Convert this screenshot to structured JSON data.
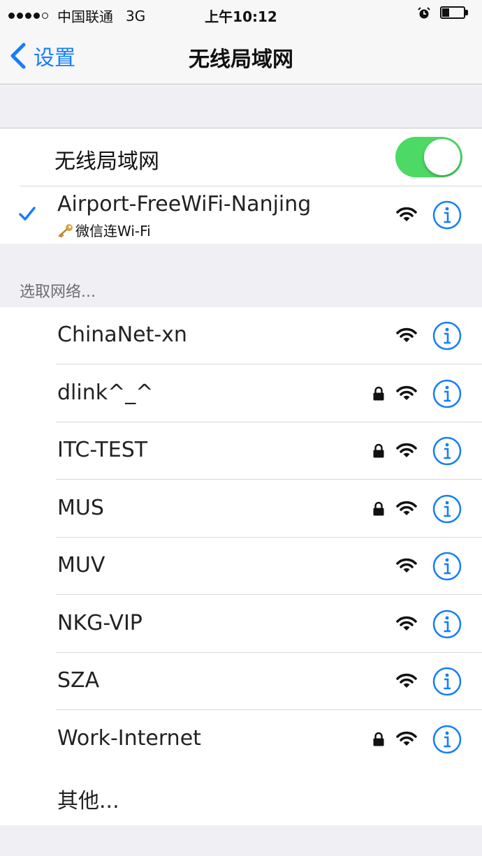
{
  "status_bar": {
    "carrier": "中国联通",
    "network": "3G",
    "time": "上午10:12"
  },
  "nav": {
    "back_label": "设置",
    "title": "无线局域网"
  },
  "wifi_toggle": {
    "label": "无线局域网",
    "on": true,
    "color": "#4cd964"
  },
  "connected": {
    "name": "Airport-FreeWiFi-Nanjing",
    "subtitle": "微信连Wi-Fi"
  },
  "section_header": "选取网络...",
  "networks": [
    {
      "name": "ChinaNet-xn",
      "locked": false
    },
    {
      "name": "dlink^_^",
      "locked": true
    },
    {
      "name": "ITC-TEST",
      "locked": true
    },
    {
      "name": "MUS",
      "locked": true
    },
    {
      "name": "MUV",
      "locked": false
    },
    {
      "name": "NKG-VIP",
      "locked": false
    },
    {
      "name": "SZA",
      "locked": false
    },
    {
      "name": "Work-Internet",
      "locked": true
    }
  ],
  "other_label": "其他...",
  "colors": {
    "accent": "#147efb",
    "background": "#efeff4"
  }
}
